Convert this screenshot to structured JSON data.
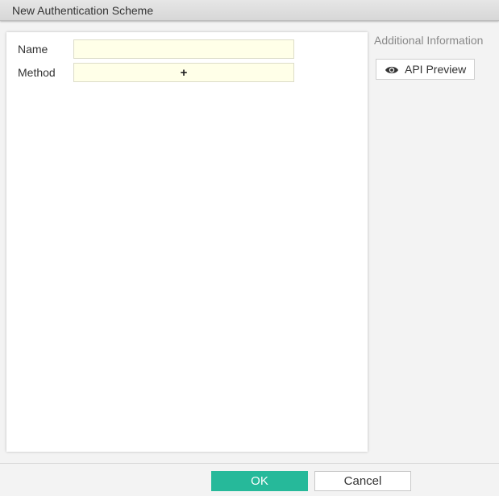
{
  "dialog": {
    "title": "New Authentication Scheme"
  },
  "form": {
    "name_label": "Name",
    "name_value": "",
    "method_label": "Method",
    "method_add_symbol": "+"
  },
  "sidebar": {
    "title": "Additional Information",
    "api_preview_label": "API Preview",
    "api_preview_icon": "eye-icon"
  },
  "footer": {
    "ok_label": "OK",
    "cancel_label": "Cancel"
  },
  "colors": {
    "accent": "#26b99a",
    "field_background": "#ffffe8"
  }
}
